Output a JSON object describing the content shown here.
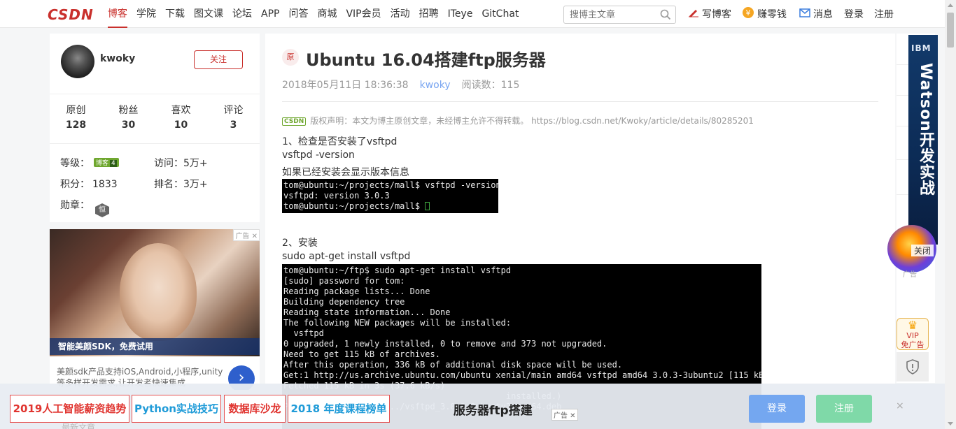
{
  "nav": {
    "logo": "CSDN",
    "items": [
      "博客",
      "学院",
      "下载",
      "图文课",
      "论坛",
      "APP",
      "问答",
      "商城",
      "VIP会员",
      "活动",
      "招聘",
      "ITeye",
      "GitChat"
    ],
    "search_placeholder": "搜博主文章",
    "write": "写博客",
    "earn": "赚零钱",
    "messages": "消息",
    "login": "登录",
    "register": "注册"
  },
  "profile": {
    "username": "kwoky",
    "follow_label": "关注",
    "stats": [
      {
        "label": "原创",
        "value": "128"
      },
      {
        "label": "粉丝",
        "value": "30"
      },
      {
        "label": "喜欢",
        "value": "10"
      },
      {
        "label": "评论",
        "value": "3"
      }
    ],
    "level_label": "等级：",
    "level_badge": "博客",
    "level_num": "4",
    "visits_label": "访问：",
    "visits_value": "5万+",
    "points_label": "积分：",
    "points_value": "1833",
    "rank_label": "排名：",
    "rank_value": "3万+",
    "medal_label": "勋章：",
    "medal_glyph": "恒"
  },
  "left_ad": {
    "tag": "广告",
    "caption": "智能美颜SDK，免费试用",
    "text": "美颜sdk产品支持iOS,Android,小程序,unity等多样开发需求,让开发者快速集成"
  },
  "article": {
    "badge": "原",
    "title": "Ubuntu 16.04搭建ftp服务器",
    "date": "2018年05月11日 18:36:38",
    "author": "kwoky",
    "reads": "阅读数：115",
    "cert": "CSDN",
    "copyright": "版权声明：本文为博主原创文章，未经博主允许不得转载。 https://blog.csdn.net/Kwoky/article/details/80285201",
    "step1": "1、检查是否安装了vsftpd",
    "cmd1": "vsftpd -version",
    "note1": "如果已经安装会显示版本信息",
    "term1": "tom@ubuntu:~/projects/mall$ vsftpd -version\nvsftpd: version 3.0.3\ntom@ubuntu:~/projects/mall$ ",
    "step2": "2、安装",
    "cmd2": "sudo apt-get install vsftpd",
    "term2": "tom@ubuntu:~/ftp$ sudo apt-get install vsftpd\n[sudo] password for tom:\nReading package lists... Done\nBuilding dependency tree\nReading state information... Done\nThe following NEW packages will be installed:\n  vsftpd\n0 upgraded, 1 newly installed, 0 to remove and 373 not upgraded.\nNeed to get 115 kB of archives.\nAfter this operation, 336 kB of additional disk space will be used.\nGet:1 http://us.archive.ubuntu.com/ubuntu xenial/main amd64 vsftpd amd64 3.0.3-3ubuntu2 [115 kB]\nFetched 115 kB in 3s (37.6 kB/s)\n                                            installed.)\nPreparing to unpack .../vsftpd_3.0.3-3ubuntu2_amd64.deb"
  },
  "right_rail": {
    "ibm_logo": "IBM",
    "ibm_text": "Watson开发实战",
    "promo_close": "关闭",
    "promo_tag": "广告",
    "vip_line1": "VIP",
    "vip_line2": "免广告"
  },
  "bottom_bar": {
    "tags": [
      "2019人工智能薪资趋势",
      "Python实战技巧",
      "数据库沙龙",
      "2018 年度课程榜单"
    ],
    "title": "服务器ftp搭建",
    "ad_tag": "广告",
    "login": "登录",
    "register": "注册",
    "close": "×",
    "behind_text": "最新文章"
  },
  "colors": {
    "brand_red": "#c9302c",
    "link_blue": "#78a5f1",
    "login_blue": "#74a7f0",
    "register_green": "#7fd9a8"
  }
}
